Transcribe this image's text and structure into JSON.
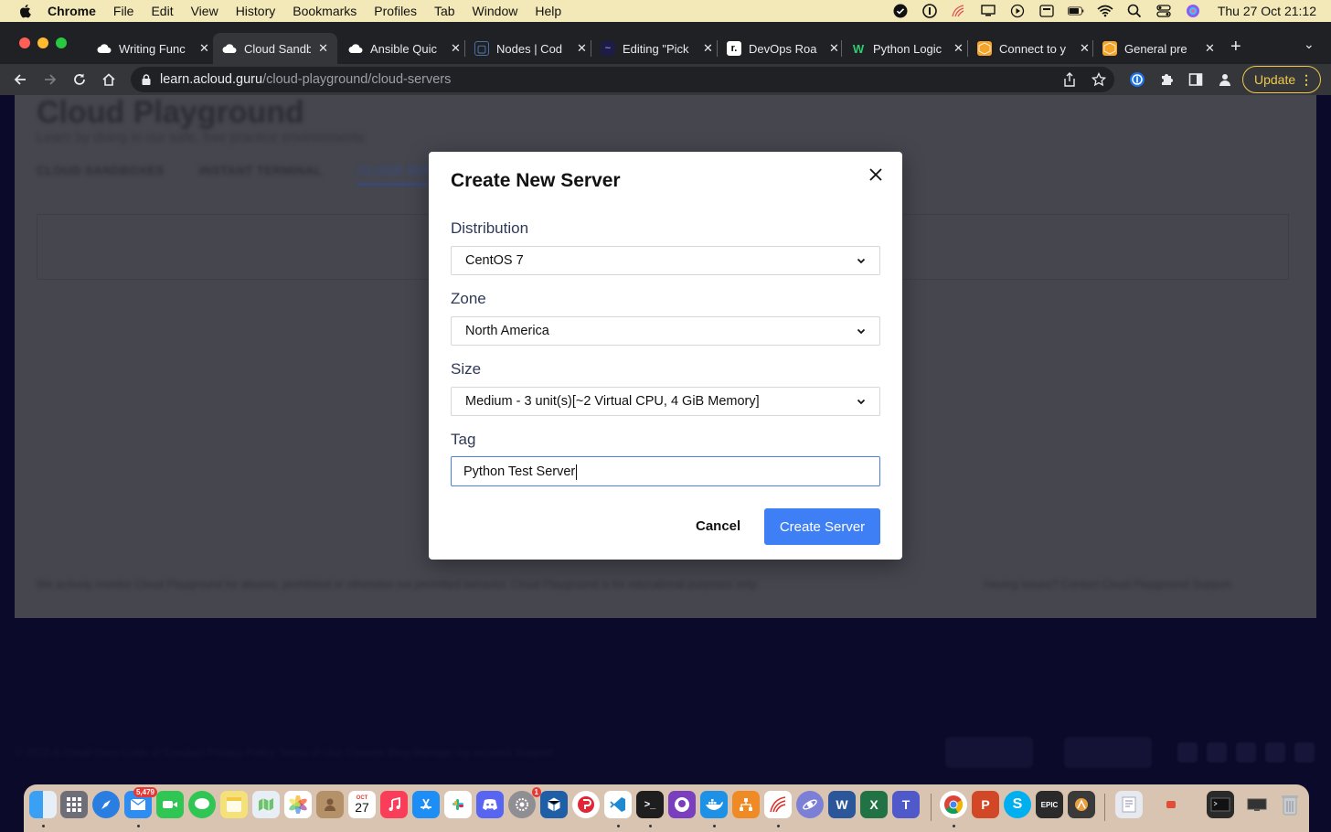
{
  "menubar": {
    "app": "Chrome",
    "items": [
      "File",
      "Edit",
      "View",
      "History",
      "Bookmarks",
      "Profiles",
      "Tab",
      "Window",
      "Help"
    ],
    "clock": "Thu 27 Oct  21:12"
  },
  "tabs": [
    {
      "title": "Writing Func",
      "icon": "cloud-icon"
    },
    {
      "title": "Cloud Sandb",
      "icon": "cloud-icon",
      "active": true
    },
    {
      "title": "Ansible Quic",
      "icon": "cloud-icon"
    },
    {
      "title": "Nodes | Cod",
      "icon": "code-icon"
    },
    {
      "title": "Editing \"Pick",
      "icon": "editor-icon"
    },
    {
      "title": "DevOps Roa",
      "icon": "roadmap-icon"
    },
    {
      "title": "Python Logic",
      "icon": "w-icon"
    },
    {
      "title": "Connect to y",
      "icon": "box-icon"
    },
    {
      "title": "General pre",
      "icon": "box-icon"
    }
  ],
  "toolbar": {
    "url_host": "learn.acloud.guru",
    "url_path": "/cloud-playground/cloud-servers",
    "update_label": "Update"
  },
  "page": {
    "title": "Cloud Playground",
    "subtitle": "Learn by doing in our safe, free practice environments",
    "tabs": [
      "CLOUD SANDBOXES",
      "INSTANT TERMINAL",
      "CLOUD SERVERS"
    ],
    "note": "We actively monitor Cloud Playground for abuses, prohibited or otherwise not permitted behavior. Cloud Playground is for educational purposes only.",
    "note_right": "Having issues? Contact Cloud Playground Support",
    "footer": "© 2022 A Cloud Guru   Code of Conduct   Privacy Policy   Terms of Use   Careers   Blog   Manage my account   Support"
  },
  "modal": {
    "title": "Create New Server",
    "distribution": {
      "label": "Distribution",
      "value": "CentOS 7"
    },
    "zone": {
      "label": "Zone",
      "value": "North America"
    },
    "size": {
      "label": "Size",
      "value": "Medium - 3 unit(s)[~2 Virtual CPU, 4 GiB Memory]"
    },
    "tag": {
      "label": "Tag",
      "value": "Python Test Server"
    },
    "cancel_label": "Cancel",
    "create_label": "Create Server"
  },
  "dock": {
    "mail_badge": "5,479",
    "settings_badge": "1",
    "calendar_month": "OCT",
    "calendar_day": "27",
    "epic_label": "EPIC"
  },
  "colors": {
    "accent": "#3f7ff6",
    "menubar": "#f3e9b8",
    "update": "#f0c94a"
  }
}
